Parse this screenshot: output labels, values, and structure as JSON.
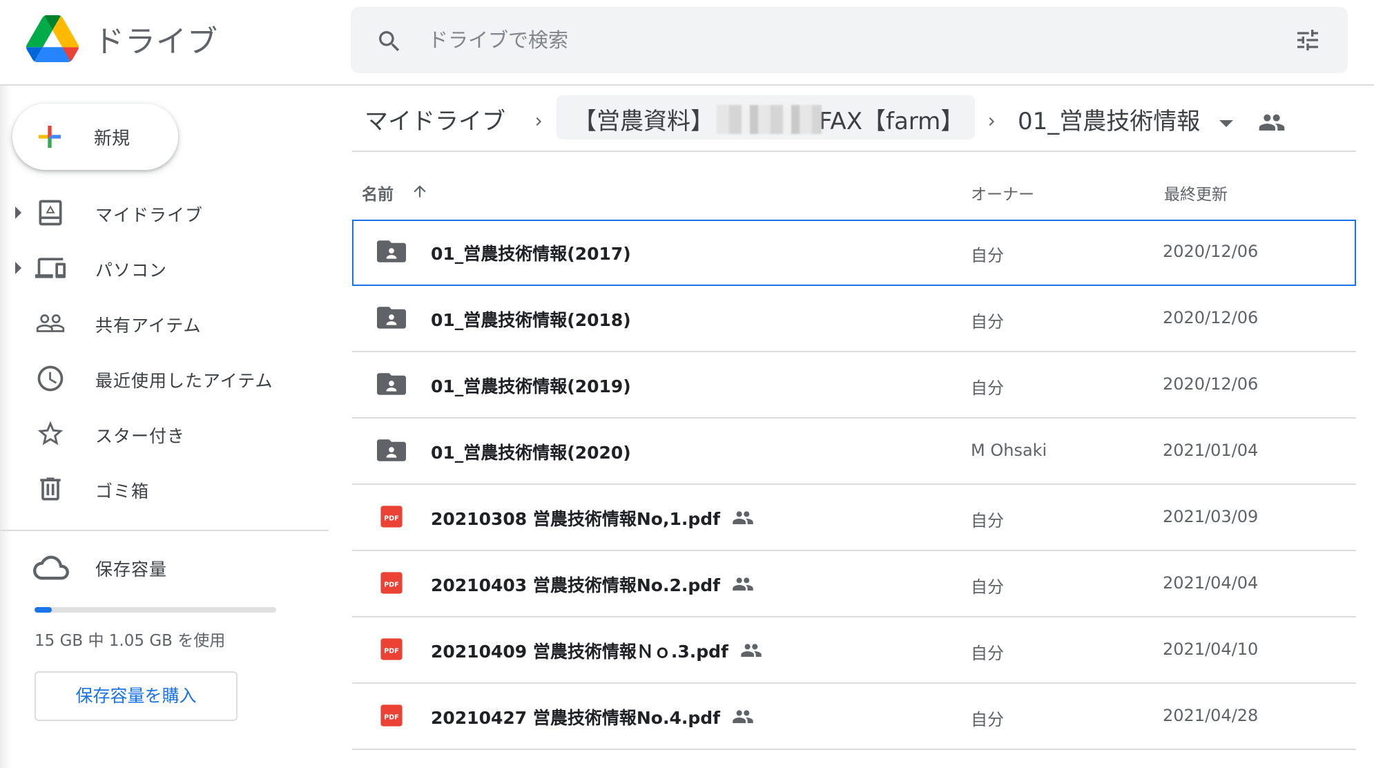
{
  "app": {
    "title": "ドライブ",
    "search_placeholder": "ドライブで検索"
  },
  "sidebar": {
    "new_label": "新規",
    "items": [
      {
        "label": "マイドライブ",
        "icon": "my-drive-icon",
        "expandable": true
      },
      {
        "label": "パソコン",
        "icon": "computers-icon",
        "expandable": true
      },
      {
        "label": "共有アイテム",
        "icon": "shared-people-icon",
        "expandable": false
      },
      {
        "label": "最近使用したアイテム",
        "icon": "clock-icon",
        "expandable": false
      },
      {
        "label": "スター付き",
        "icon": "star-icon",
        "expandable": false
      },
      {
        "label": "ゴミ箱",
        "icon": "trash-icon",
        "expandable": false
      }
    ],
    "storage": {
      "label": "保存容量",
      "usage_text": "15 GB 中 1.05 GB を使用",
      "used_fraction": 0.07,
      "buy_label": "保存容量を購入"
    }
  },
  "breadcrumb": {
    "root": "マイドライブ",
    "folder_prefix": "【営農資料】",
    "folder_suffix": "FAX【farm】",
    "current": "01_営農技術情報"
  },
  "columns": {
    "name": "名前",
    "owner": "オーナー",
    "modified": "最終更新"
  },
  "files": [
    {
      "type": "shared-folder",
      "name": "01_営農技術情報(2017)",
      "owner": "自分",
      "modified": "2020/12/06",
      "shared": false,
      "selected": true
    },
    {
      "type": "shared-folder",
      "name": "01_営農技術情報(2018)",
      "owner": "自分",
      "modified": "2020/12/06",
      "shared": false,
      "selected": false
    },
    {
      "type": "shared-folder",
      "name": "01_営農技術情報(2019)",
      "owner": "自分",
      "modified": "2020/12/06",
      "shared": false,
      "selected": false
    },
    {
      "type": "shared-folder",
      "name": "01_営農技術情報(2020)",
      "owner": "M Ohsaki",
      "modified": "2021/01/04",
      "shared": false,
      "selected": false
    },
    {
      "type": "pdf",
      "name": "20210308 営農技術情報No,1.pdf",
      "owner": "自分",
      "modified": "2021/03/09",
      "shared": true,
      "selected": false
    },
    {
      "type": "pdf",
      "name": "20210403 営農技術情報No.2.pdf",
      "owner": "自分",
      "modified": "2021/04/04",
      "shared": true,
      "selected": false
    },
    {
      "type": "pdf",
      "name": "20210409 営農技術情報Ｎｏ.3.pdf",
      "owner": "自分",
      "modified": "2021/04/10",
      "shared": true,
      "selected": false
    },
    {
      "type": "pdf",
      "name": "20210427 営農技術情報No.4.pdf",
      "owner": "自分",
      "modified": "2021/04/28",
      "shared": true,
      "selected": false
    }
  ],
  "colors": {
    "accent": "#1a73e8",
    "pdf_red": "#ea4335",
    "icon_grey": "#5f6368"
  }
}
